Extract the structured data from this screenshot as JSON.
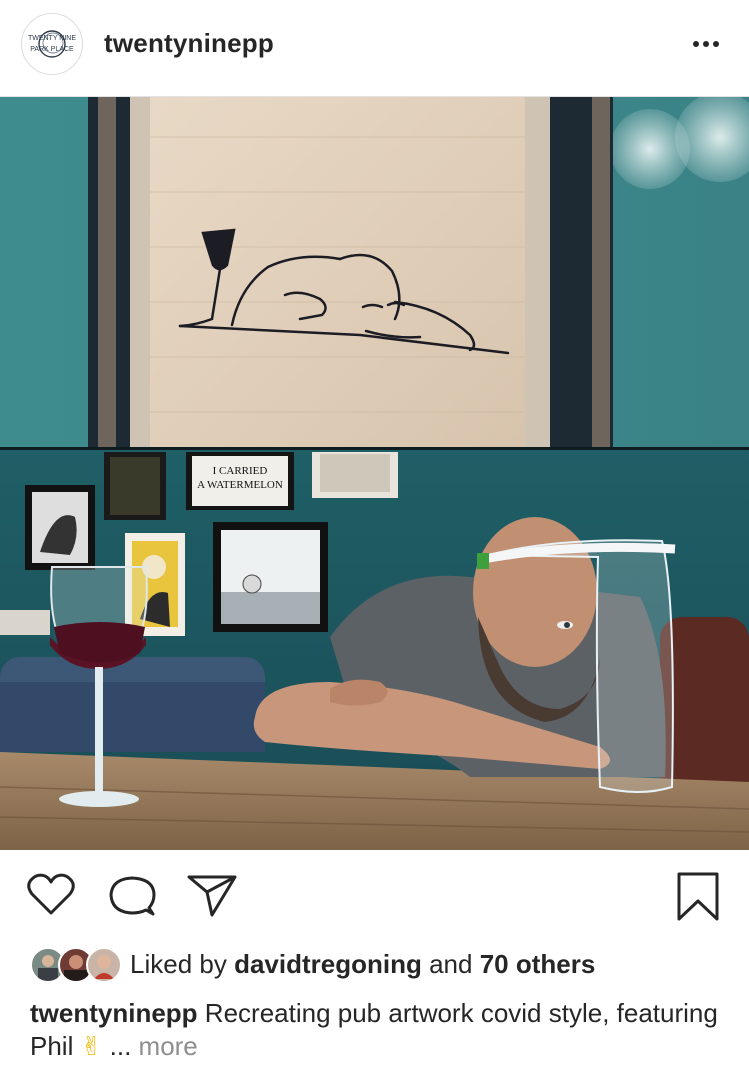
{
  "post": {
    "username": "twentyninepp",
    "avatar_text": [
      "TWENTY NINE",
      "PARK PLACE"
    ],
    "more_icon": "ellipsis-horizontal-icon"
  },
  "photo": {
    "artwork_text": [
      "I CARRIED",
      "A WATERMELON"
    ]
  },
  "actions": {
    "like_icon": "heart-icon",
    "comment_icon": "comment-bubble-icon",
    "share_icon": "paper-plane-icon",
    "save_icon": "bookmark-icon"
  },
  "likes": {
    "prefix": "Liked by",
    "user": "davidtregoning",
    "conjunction": "and",
    "others": "70 others"
  },
  "caption": {
    "username": "twentyninepp",
    "text": "Recreating pub artwork covid style, featuring Phil",
    "emoji": "✌",
    "ellipsis": "...",
    "more": "more"
  }
}
